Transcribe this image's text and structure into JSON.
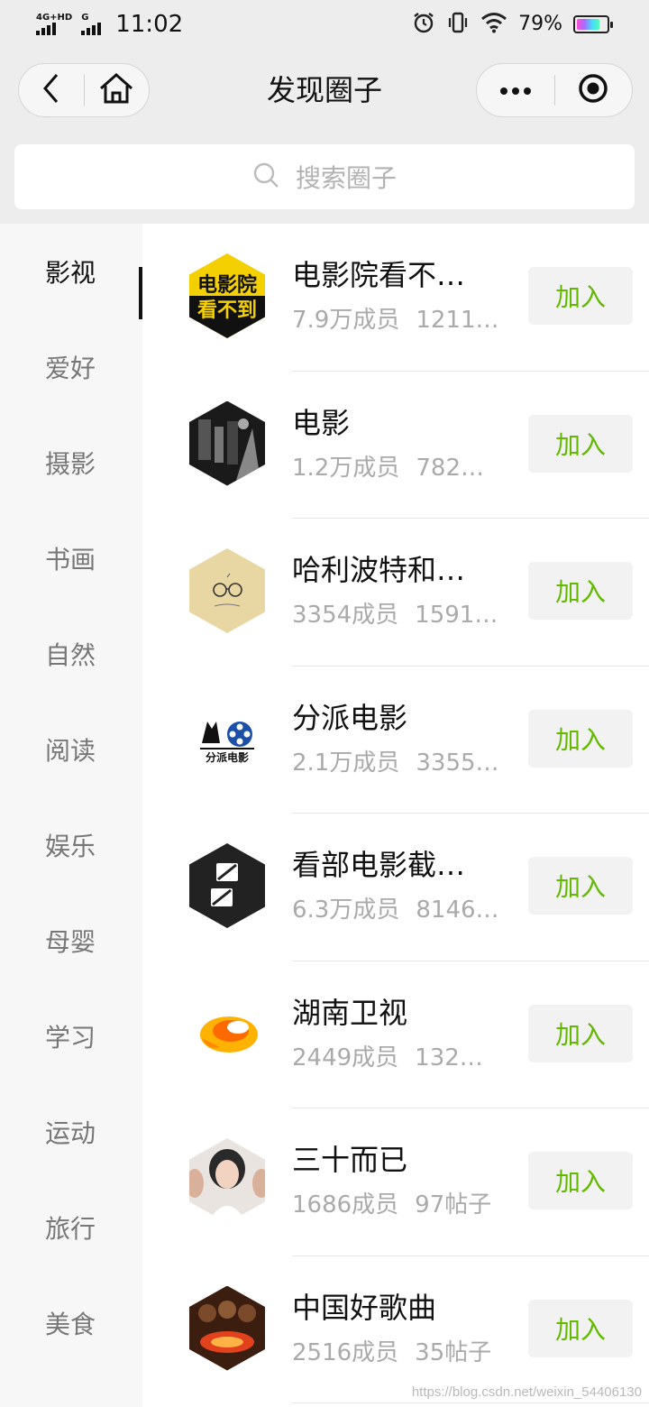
{
  "status_bar": {
    "network_left": "4G+HD",
    "network_right": "G",
    "time": "11:02",
    "battery_percent": "79%",
    "icons": [
      "alarm-icon",
      "vibrate-icon",
      "wifi-icon",
      "battery-icon"
    ]
  },
  "nav": {
    "title": "发现圈子",
    "back_icon": "back-arrow-icon",
    "home_icon": "home-icon",
    "more_icon": "more-dots-icon",
    "close_icon": "target-close-icon"
  },
  "search": {
    "placeholder": "搜索圈子"
  },
  "categories": [
    {
      "label": "影视",
      "active": true
    },
    {
      "label": "爱好",
      "active": false
    },
    {
      "label": "摄影",
      "active": false
    },
    {
      "label": "书画",
      "active": false
    },
    {
      "label": "自然",
      "active": false
    },
    {
      "label": "阅读",
      "active": false
    },
    {
      "label": "娱乐",
      "active": false
    },
    {
      "label": "母婴",
      "active": false
    },
    {
      "label": "学习",
      "active": false
    },
    {
      "label": "运动",
      "active": false
    },
    {
      "label": "旅行",
      "active": false
    },
    {
      "label": "美食",
      "active": false
    }
  ],
  "circles": [
    {
      "name": "电影院看不…",
      "members": "7.9万成员",
      "posts": "1211…",
      "join": "加入",
      "avatar_text_1": "电影院",
      "avatar_text_2": "看不到"
    },
    {
      "name": "电影",
      "members": "1.2万成员",
      "posts": "782…",
      "join": "加入"
    },
    {
      "name": "哈利波特和…",
      "members": "3354成员",
      "posts": "1591…",
      "join": "加入"
    },
    {
      "name": "分派电影",
      "members": "2.1万成员",
      "posts": "3355…",
      "join": "加入",
      "avatar_text_1": "分派电影"
    },
    {
      "name": "看部电影截…",
      "members": "6.3万成员",
      "posts": "8146…",
      "join": "加入"
    },
    {
      "name": "湖南卫视",
      "members": "2449成员",
      "posts": "132…",
      "join": "加入"
    },
    {
      "name": "三十而已",
      "members": "1686成员",
      "posts": "97帖子",
      "join": "加入"
    },
    {
      "name": "中国好歌曲",
      "members": "2516成员",
      "posts": "35帖子",
      "join": "加入"
    }
  ],
  "colors": {
    "accent_green": "#62b900",
    "background": "#ededed"
  },
  "watermark": "https://blog.csdn.net/weixin_54406130"
}
